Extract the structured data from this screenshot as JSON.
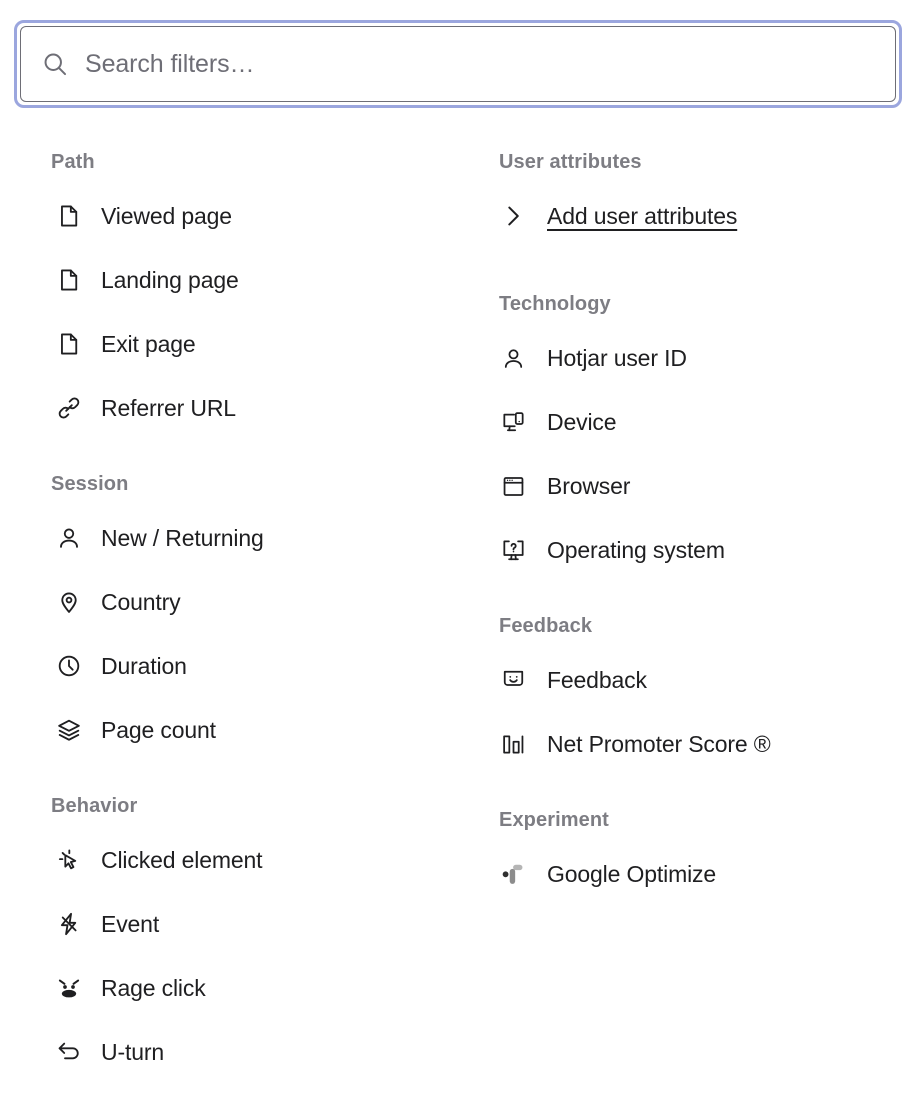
{
  "search": {
    "placeholder": "Search filters…",
    "value": "",
    "icon": "search-icon",
    "focused": true,
    "focus_ring_color": "#9ba6de",
    "border_color": "#6e6e76"
  },
  "colors": {
    "background": "#ffffff",
    "group_title": "#7d7d83",
    "item_text": "#1f1f21",
    "icon_stroke": "#1f1f21",
    "optimize_dark": "#2f2f2f",
    "optimize_mid": "#8c8c8c",
    "optimize_light": "#b5b5b5"
  },
  "left_column": [
    {
      "title": "Path",
      "items": [
        {
          "label": "Viewed page",
          "icon": "document-icon"
        },
        {
          "label": "Landing page",
          "icon": "document-icon"
        },
        {
          "label": "Exit page",
          "icon": "document-icon"
        },
        {
          "label": "Referrer URL",
          "icon": "link-icon"
        }
      ]
    },
    {
      "title": "Session",
      "items": [
        {
          "label": "New / Returning",
          "icon": "user-icon"
        },
        {
          "label": "Country",
          "icon": "location-pin-icon"
        },
        {
          "label": "Duration",
          "icon": "clock-icon"
        },
        {
          "label": "Page count",
          "icon": "layers-icon"
        }
      ]
    },
    {
      "title": "Behavior",
      "items": [
        {
          "label": "Clicked element",
          "icon": "cursor-click-icon"
        },
        {
          "label": "Event",
          "icon": "lightning-bolt-icon"
        },
        {
          "label": "Rage click",
          "icon": "rage-click-icon"
        },
        {
          "label": "U-turn",
          "icon": "u-turn-arrow-icon"
        }
      ]
    }
  ],
  "right_column": [
    {
      "title": "User attributes",
      "items": [
        {
          "label": "Add user attributes",
          "icon": "chevron-right-icon",
          "link": true
        }
      ]
    },
    {
      "title": "Technology",
      "items": [
        {
          "label": "Hotjar user ID",
          "icon": "user-icon"
        },
        {
          "label": "Device",
          "icon": "device-icon"
        },
        {
          "label": "Browser",
          "icon": "browser-window-icon"
        },
        {
          "label": "Operating system",
          "icon": "operating-system-icon"
        }
      ]
    },
    {
      "title": "Feedback",
      "items": [
        {
          "label": "Feedback",
          "icon": "smiley-feedback-icon"
        },
        {
          "label": "Net Promoter Score ®",
          "icon": "bar-chart-icon"
        }
      ]
    },
    {
      "title": "Experiment",
      "items": [
        {
          "label": "Google Optimize",
          "icon": "google-optimize-icon"
        }
      ]
    }
  ]
}
